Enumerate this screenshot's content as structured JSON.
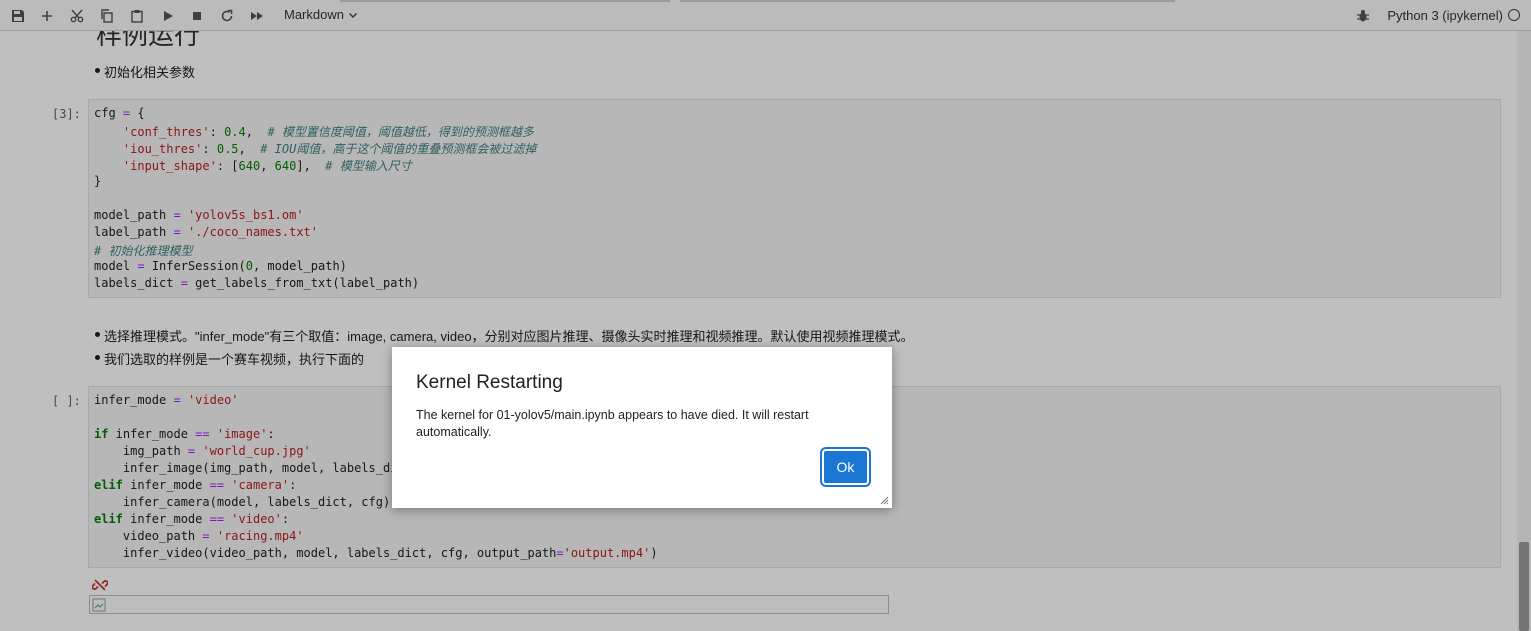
{
  "toolbar": {
    "cell_type": "Markdown",
    "kernel_name": "Python 3 (ipykernel)",
    "icons": [
      "save-icon",
      "add-cell-icon",
      "cut-icon",
      "copy-icon",
      "paste-icon",
      "run-icon",
      "stop-icon",
      "restart-icon",
      "fast-forward-icon",
      "bug-icon",
      "kernel-status-icon"
    ]
  },
  "notebook": {
    "partial_heading": "样例运行",
    "bullet_1": "初始化相关参数",
    "cell_1": {
      "prompt": "[3]:",
      "lines": [
        [
          [
            "",
            "cfg "
          ],
          [
            "op",
            "="
          ],
          [
            "",
            " {"
          ]
        ],
        [
          [
            "",
            "    "
          ],
          [
            "str",
            "'conf_thres'"
          ],
          [
            "",
            ": "
          ],
          [
            "num",
            "0.4"
          ],
          [
            "",
            ",  "
          ],
          [
            "cm",
            "# 模型置信度阈值，阈值越低，得到的预测框越多"
          ]
        ],
        [
          [
            "",
            "    "
          ],
          [
            "str",
            "'iou_thres'"
          ],
          [
            "",
            ": "
          ],
          [
            "num",
            "0.5"
          ],
          [
            "",
            ",  "
          ],
          [
            "cm",
            "# IOU阈值，高于这个阈值的重叠预测框会被过滤掉"
          ]
        ],
        [
          [
            "",
            "    "
          ],
          [
            "str",
            "'input_shape'"
          ],
          [
            "",
            ": ["
          ],
          [
            "num",
            "640"
          ],
          [
            "",
            ", "
          ],
          [
            "num",
            "640"
          ],
          [
            "",
            "],  "
          ],
          [
            "cm",
            "# 模型输入尺寸"
          ]
        ],
        [
          [
            "",
            "}"
          ]
        ],
        [
          [
            "",
            ""
          ]
        ],
        [
          [
            "",
            "model_path "
          ],
          [
            "op",
            "="
          ],
          [
            "",
            " "
          ],
          [
            "str",
            "'yolov5s_bs1.om'"
          ]
        ],
        [
          [
            "",
            "label_path "
          ],
          [
            "op",
            "="
          ],
          [
            "",
            " "
          ],
          [
            "str",
            "'./coco_names.txt'"
          ]
        ],
        [
          [
            "cm",
            "# 初始化推理模型"
          ]
        ],
        [
          [
            "",
            "model "
          ],
          [
            "op",
            "="
          ],
          [
            "",
            " InferSession("
          ],
          [
            "num",
            "0"
          ],
          [
            "",
            ", model_path)"
          ]
        ],
        [
          [
            "",
            "labels_dict "
          ],
          [
            "op",
            "="
          ],
          [
            "",
            " get_labels_from_txt(label_path)"
          ]
        ]
      ]
    },
    "bullet_2": "选择推理模式。\"infer_mode\"有三个取值：image, camera, video，分别对应图片推理、摄像头实时推理和视频推理。默认使用视频推理模式。",
    "bullet_3": "我们选取的样例是一个赛车视频，执行下面的",
    "cell_2": {
      "prompt": "[ ]:",
      "lines": [
        [
          [
            "",
            "infer_mode "
          ],
          [
            "op",
            "="
          ],
          [
            "",
            " "
          ],
          [
            "str",
            "'video'"
          ]
        ],
        [
          [
            "",
            ""
          ]
        ],
        [
          [
            "kw",
            "if"
          ],
          [
            "",
            " infer_mode "
          ],
          [
            "op",
            "=="
          ],
          [
            "",
            " "
          ],
          [
            "str",
            "'image'"
          ],
          [
            "",
            ":"
          ]
        ],
        [
          [
            "",
            "    img_path "
          ],
          [
            "op",
            "="
          ],
          [
            "",
            " "
          ],
          [
            "str",
            "'world_cup.jpg'"
          ]
        ],
        [
          [
            "",
            "    infer_image(img_path, model, labels_dict, cfg)"
          ]
        ],
        [
          [
            "kw",
            "elif"
          ],
          [
            "",
            " infer_mode "
          ],
          [
            "op",
            "=="
          ],
          [
            "",
            " "
          ],
          [
            "str",
            "'camera'"
          ],
          [
            "",
            ":"
          ]
        ],
        [
          [
            "",
            "    infer_camera(model, labels_dict, cfg)"
          ]
        ],
        [
          [
            "kw",
            "elif"
          ],
          [
            "",
            " infer_mode "
          ],
          [
            "op",
            "=="
          ],
          [
            "",
            " "
          ],
          [
            "str",
            "'video'"
          ],
          [
            "",
            ":"
          ]
        ],
        [
          [
            "",
            "    video_path "
          ],
          [
            "op",
            "="
          ],
          [
            "",
            " "
          ],
          [
            "str",
            "'racing.mp4'"
          ]
        ],
        [
          [
            "",
            "    infer_video(video_path, model, labels_dict, cfg, output_path"
          ],
          [
            "op",
            "="
          ],
          [
            "str",
            "'output.mp4'"
          ],
          [
            "",
            ")"
          ]
        ]
      ]
    }
  },
  "dialog": {
    "title": "Kernel Restarting",
    "body": "The kernel for 01-yolov5/main.ipynb appears to have died. It will restart automatically.",
    "ok_label": "Ok"
  },
  "colors": {
    "accent": "#1976d2",
    "string": "#ba2121",
    "keyword": "#008000",
    "comment": "#408080",
    "operator": "#aa22ff"
  }
}
